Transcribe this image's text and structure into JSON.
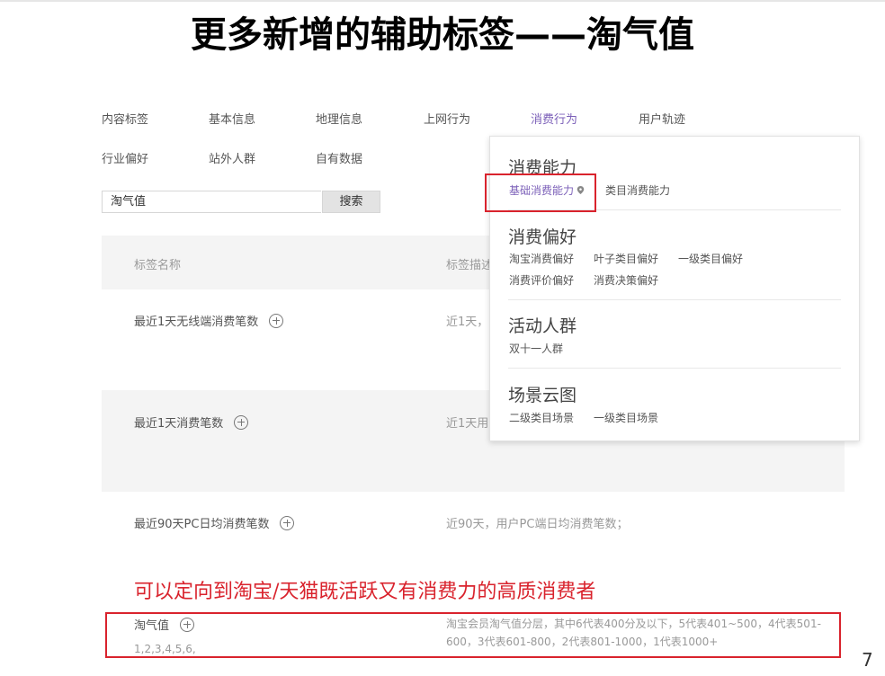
{
  "slide_title": "更多新增的辅助标签——淘气值",
  "nav": {
    "row1": [
      "内容标签",
      "基本信息",
      "地理信息",
      "上网行为",
      "消费行为",
      "用户轨迹"
    ],
    "row2": [
      "行业偏好",
      "站外人群",
      "自有数据"
    ],
    "active": "消费行为"
  },
  "search": {
    "value": "淘气值",
    "button_label": "搜索"
  },
  "table": {
    "headers": [
      "标签名称",
      "标签描述"
    ],
    "rows": [
      {
        "name": "最近1天无线端消费笔数",
        "desc": "近1天，"
      },
      {
        "name": "最近1天消费笔数",
        "desc": "近1天用"
      },
      {
        "name": "最近90天PC日均消费笔数",
        "desc": "近90天，用户PC端日均消费笔数；"
      }
    ],
    "highlight_row": {
      "name": "淘气值",
      "values": "1,2,3,4,5,6,",
      "desc": "淘宝会员淘气值分层，其中6代表400分及以下，5代表401~500，4代表501-600，3代表601-800，2代表801-1000，1代表1000+"
    }
  },
  "dropdown": {
    "sections": [
      {
        "title": "消费能力",
        "items": [
          "基础消费能力",
          "类目消费能力"
        ]
      },
      {
        "title": "消费偏好",
        "items": [
          "淘宝消费偏好",
          "叶子类目偏好",
          "一级类目偏好",
          "消费评价偏好",
          "消费决策偏好"
        ]
      },
      {
        "title": "活动人群",
        "items": [
          "双十一人群"
        ]
      },
      {
        "title": "场景云图",
        "items": [
          "二级类目场景",
          "一级类目场景"
        ]
      }
    ],
    "active_item": "基础消费能力"
  },
  "annotation": "可以定向到淘宝/天猫既活跃又有消费力的高质消费者",
  "edge_glyph": "7",
  "colors": {
    "accent": "#7b5fb8",
    "highlight": "#d9232d"
  }
}
